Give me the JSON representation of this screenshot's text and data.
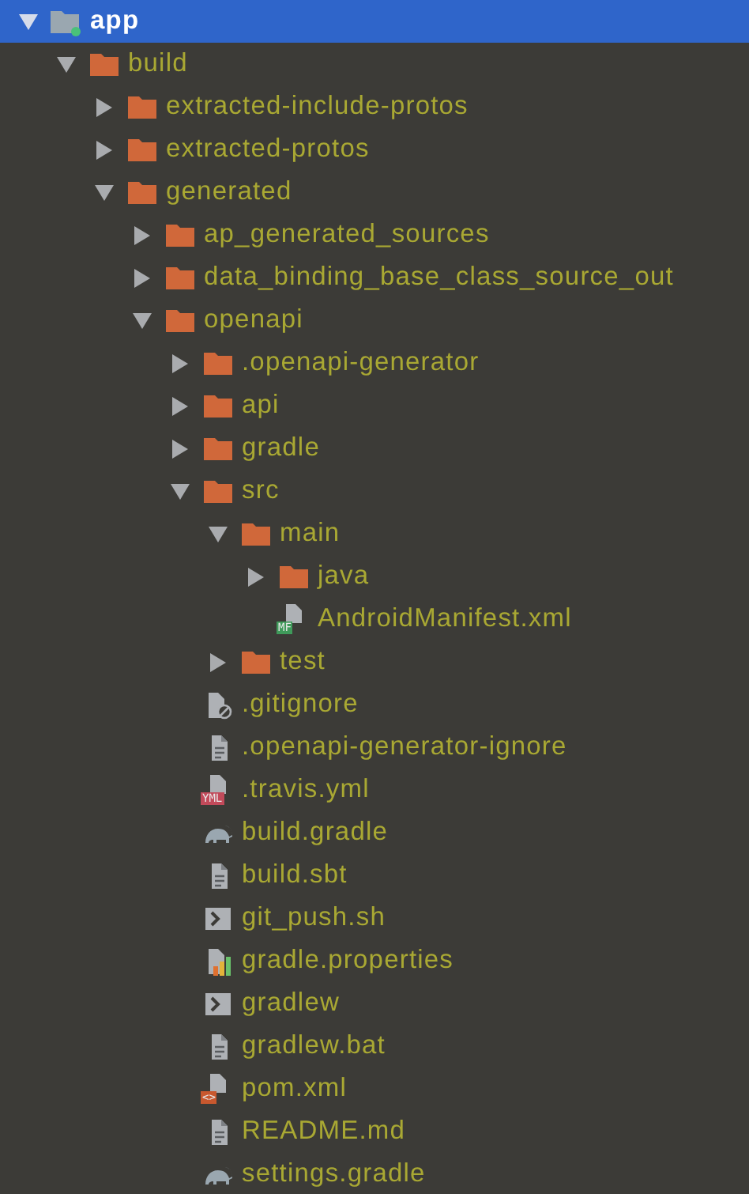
{
  "tree": [
    {
      "kind": "module",
      "label": "app",
      "selected": true,
      "expanded": true,
      "children": [
        {
          "kind": "folder",
          "label": "build",
          "selected": false,
          "expanded": true,
          "children": [
            {
              "kind": "folder",
              "label": "extracted-include-protos",
              "selected": false,
              "expanded": false
            },
            {
              "kind": "folder",
              "label": "extracted-protos",
              "selected": false,
              "expanded": false
            },
            {
              "kind": "folder",
              "label": "generated",
              "selected": false,
              "expanded": true,
              "children": [
                {
                  "kind": "folder",
                  "label": "ap_generated_sources",
                  "selected": false,
                  "expanded": false
                },
                {
                  "kind": "folder",
                  "label": "data_binding_base_class_source_out",
                  "selected": false,
                  "expanded": false
                },
                {
                  "kind": "folder",
                  "label": "openapi",
                  "selected": false,
                  "expanded": true,
                  "children": [
                    {
                      "kind": "folder",
                      "label": ".openapi-generator",
                      "selected": false,
                      "expanded": false
                    },
                    {
                      "kind": "folder",
                      "label": "api",
                      "selected": false,
                      "expanded": false
                    },
                    {
                      "kind": "folder",
                      "label": "gradle",
                      "selected": false,
                      "expanded": false
                    },
                    {
                      "kind": "folder",
                      "label": "src",
                      "selected": false,
                      "expanded": true,
                      "children": [
                        {
                          "kind": "folder",
                          "label": "main",
                          "selected": false,
                          "expanded": true,
                          "children": [
                            {
                              "kind": "folder",
                              "label": "java",
                              "selected": false,
                              "expanded": false
                            },
                            {
                              "kind": "badge-file",
                              "label": "AndroidManifest.xml",
                              "selected": false,
                              "badge": "MF",
                              "color": "#3f9a5a"
                            }
                          ]
                        },
                        {
                          "kind": "folder",
                          "label": "test",
                          "selected": false,
                          "expanded": false
                        }
                      ]
                    },
                    {
                      "kind": "ignore",
                      "label": ".gitignore",
                      "selected": false
                    },
                    {
                      "kind": "text",
                      "label": ".openapi-generator-ignore",
                      "selected": false
                    },
                    {
                      "kind": "badge-file",
                      "label": ".travis.yml",
                      "selected": false,
                      "badge": "YML",
                      "color": "#c24a5a"
                    },
                    {
                      "kind": "gradle",
                      "label": "build.gradle",
                      "selected": false
                    },
                    {
                      "kind": "text",
                      "label": "build.sbt",
                      "selected": false
                    },
                    {
                      "kind": "shell",
                      "label": "git_push.sh",
                      "selected": false
                    },
                    {
                      "kind": "properties",
                      "label": "gradle.properties",
                      "selected": false
                    },
                    {
                      "kind": "shell",
                      "label": "gradlew",
                      "selected": false
                    },
                    {
                      "kind": "text",
                      "label": "gradlew.bat",
                      "selected": false
                    },
                    {
                      "kind": "badge-file",
                      "label": "pom.xml",
                      "selected": false,
                      "badge": "<>",
                      "color": "#c8582e"
                    },
                    {
                      "kind": "text",
                      "label": "README.md",
                      "selected": false
                    },
                    {
                      "kind": "gradle",
                      "label": "settings.gradle",
                      "selected": false
                    }
                  ]
                }
              ]
            }
          ]
        }
      ]
    }
  ]
}
